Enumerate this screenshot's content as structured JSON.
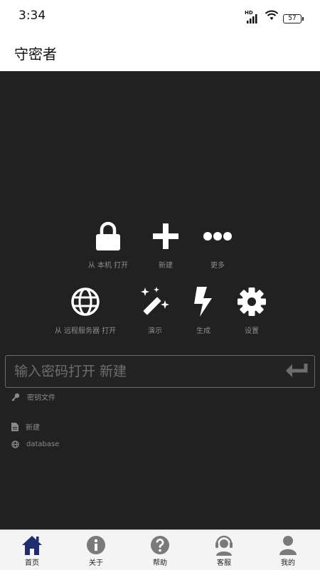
{
  "status_bar": {
    "time": "3:34",
    "network_badge": "HD",
    "battery": "57"
  },
  "app_bar": {
    "title": "守密者"
  },
  "actions": {
    "open_local": "从 本机 打开",
    "new": "新建",
    "more": "更多",
    "open_remote": "从 远程服务器 打开",
    "demo": "演示",
    "generate": "生成",
    "settings": "设置"
  },
  "password_input": {
    "placeholder": "输入密码打开 新建",
    "value": ""
  },
  "files": {
    "key_file": "密钥文件",
    "new_file": "新建",
    "database": "database"
  },
  "bottom_nav": {
    "items": [
      {
        "label": "首页",
        "icon": "home-icon",
        "active": true
      },
      {
        "label": "关于",
        "icon": "info-icon",
        "active": false
      },
      {
        "label": "帮助",
        "icon": "help-icon",
        "active": false
      },
      {
        "label": "客服",
        "icon": "headset-icon",
        "active": false
      },
      {
        "label": "我的",
        "icon": "profile-icon",
        "active": false
      }
    ]
  },
  "colors": {
    "background": "#212121",
    "icon": "#ffffff",
    "label": "#8c8c8c",
    "nav_active": "#1f2d6e",
    "nav_inactive": "#7a7a7a"
  }
}
